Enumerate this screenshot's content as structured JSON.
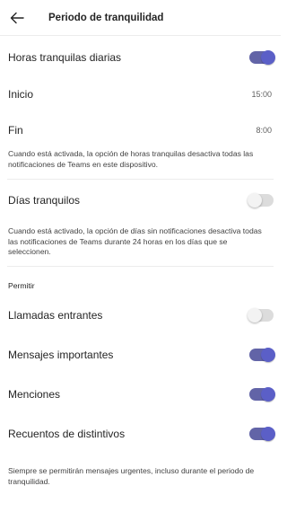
{
  "header": {
    "title": "Periodo de tranquilidad"
  },
  "daily_quiet": {
    "label": "Horas tranquilas diarias",
    "enabled": true,
    "start_label": "Inicio",
    "start_value": "15:00",
    "end_label": "Fin",
    "end_value": "8:00",
    "note": "Cuando está activada, la opción de horas tranquilas desactiva todas las notificaciones de Teams en este dispositivo."
  },
  "quiet_days": {
    "label": "Días tranquilos",
    "enabled": false,
    "note": "Cuando está activado, la opción de días sin notificaciones desactiva todas las notificaciones de Teams durante 24 horas en los días que se seleccionen."
  },
  "allow": {
    "section_label": "Permitir",
    "items": [
      {
        "label": "Llamadas entrantes",
        "enabled": false
      },
      {
        "label": "Mensajes importantes",
        "enabled": true
      },
      {
        "label": "Menciones",
        "enabled": true
      },
      {
        "label": "Recuentos de distintivos",
        "enabled": true
      }
    ],
    "footer_note": "Siempre se permitirán mensajes urgentes, incluso durante el periodo de tranquilidad."
  },
  "colors": {
    "accent": "#5b5fc7",
    "toggle_off_track": "#dcdcdc"
  }
}
